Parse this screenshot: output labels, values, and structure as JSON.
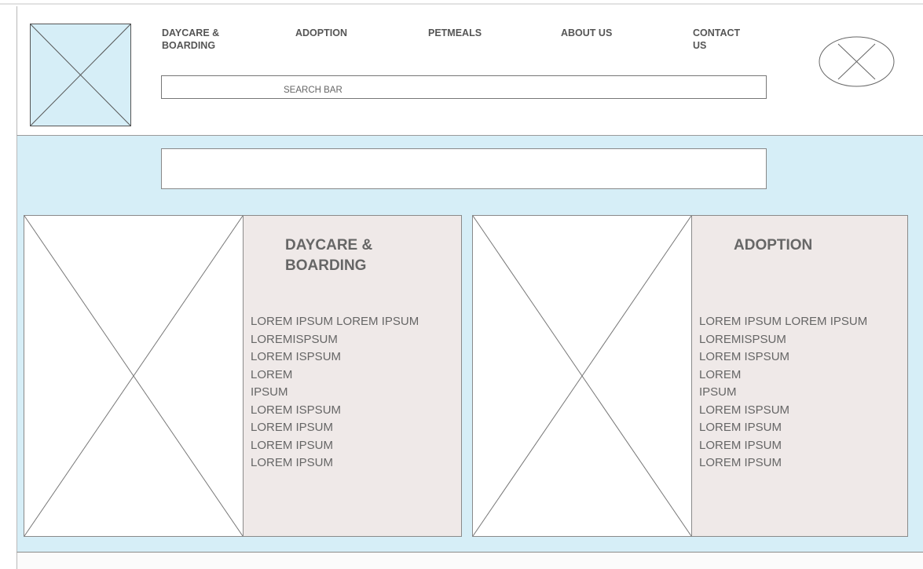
{
  "nav": {
    "items": [
      {
        "label": "DAYCARE &\nBOARDING"
      },
      {
        "label": "ADOPTION"
      },
      {
        "label": "PETMEALS"
      },
      {
        "label": "ABOUT US"
      },
      {
        "label": "CONTACT\nUS"
      }
    ]
  },
  "search": {
    "placeholder": "SEARCH BAR"
  },
  "cards": [
    {
      "title": "DAYCARE &\nBOARDING",
      "lines": [
        "LOREM IPSUM LOREM IPSUM",
        "LOREMISPSUM",
        "LOREM ISPSUM",
        "LOREM",
        "IPSUM",
        "LOREM ISPSUM",
        "LOREM IPSUM",
        "LOREM IPSUM",
        "LOREM IPSUM"
      ]
    },
    {
      "title": "ADOPTION",
      "lines": [
        "LOREM IPSUM LOREM IPSUM",
        "LOREMISPSUM",
        "LOREM ISPSUM",
        "LOREM",
        "IPSUM",
        "LOREM ISPSUM",
        "LOREM IPSUM",
        "LOREM IPSUM",
        "LOREM IPSUM"
      ]
    }
  ],
  "icons": {
    "logo": "image-placeholder-icon",
    "profile": "profile-placeholder-icon",
    "card_image": "image-placeholder-icon"
  },
  "colors": {
    "accent_band": "#d6eef7",
    "card_text_bg": "#efe9e8"
  }
}
